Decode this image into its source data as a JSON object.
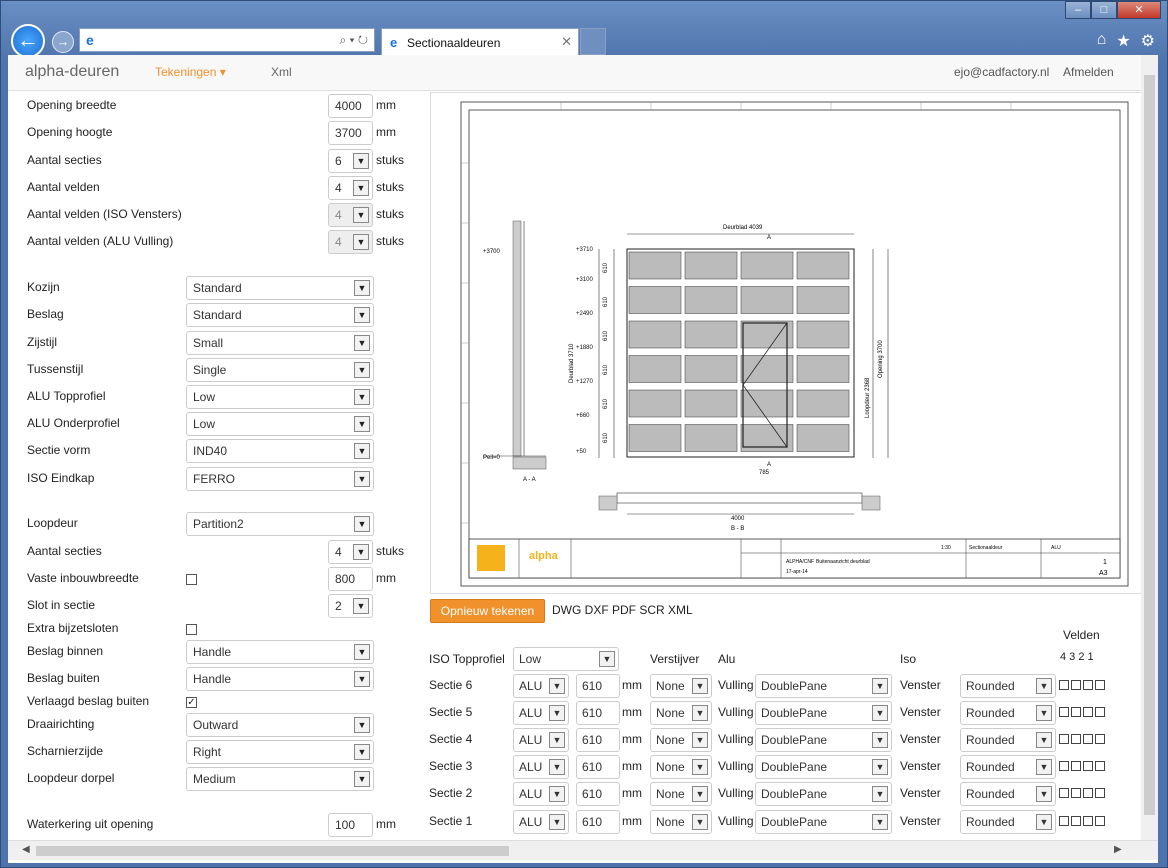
{
  "browser": {
    "tab_title": "Sectionaaldeuren",
    "address": ""
  },
  "nav": {
    "brand": "alpha-deuren",
    "menu_tekeningen": "Tekeningen",
    "menu_xml": "Xml",
    "user": "ejo@cadfactory.nl",
    "logout": "Afmelden"
  },
  "form1": [
    {
      "label": "Opening breedte",
      "value": "4000",
      "unit": "mm",
      "type": "input"
    },
    {
      "label": "Opening hoogte",
      "value": "3700",
      "unit": "mm",
      "type": "input"
    },
    {
      "label": "Aantal secties",
      "value": "6",
      "unit": "stuks",
      "type": "select"
    },
    {
      "label": "Aantal velden",
      "value": "4",
      "unit": "stuks",
      "type": "select"
    },
    {
      "label": "Aantal velden (ISO Vensters)",
      "value": "4",
      "unit": "stuks",
      "type": "select-disabled"
    },
    {
      "label": "Aantal velden (ALU Vulling)",
      "value": "4",
      "unit": "stuks",
      "type": "select-disabled"
    }
  ],
  "form2": [
    {
      "label": "Kozijn",
      "value": "Standard"
    },
    {
      "label": "Beslag",
      "value": "Standard"
    },
    {
      "label": "Zijstijl",
      "value": "Small"
    },
    {
      "label": "Tussenstijl",
      "value": "Single"
    },
    {
      "label": "ALU Topprofiel",
      "value": "Low"
    },
    {
      "label": "ALU Onderprofiel",
      "value": "Low"
    },
    {
      "label": "Sectie vorm",
      "value": "IND40"
    },
    {
      "label": "ISO Eindkap",
      "value": "FERRO"
    }
  ],
  "form3": {
    "loopdeur": {
      "label": "Loopdeur",
      "value": "Partition2"
    },
    "aantal_secties": {
      "label": "Aantal secties",
      "value": "4",
      "unit": "stuks"
    },
    "vaste": {
      "label": "Vaste inbouwbreedte",
      "value": "800",
      "unit": "mm"
    },
    "slot": {
      "label": "Slot in sectie",
      "value": "2"
    },
    "extra": {
      "label": "Extra bijzetsloten"
    },
    "beslag_binnen": {
      "label": "Beslag binnen",
      "value": "Handle"
    },
    "beslag_buiten": {
      "label": "Beslag buiten",
      "value": "Handle"
    },
    "verlaagd": {
      "label": "Verlaagd beslag buiten"
    },
    "draairichting": {
      "label": "Draairichting",
      "value": "Outward"
    },
    "scharnierzijde": {
      "label": "Scharnierzijde",
      "value": "Right"
    },
    "dorpel": {
      "label": "Loopdeur dorpel",
      "value": "Medium"
    },
    "waterkering": {
      "label": "Waterkering uit opening",
      "value": "100",
      "unit": "mm"
    }
  },
  "actions": {
    "redraw": "Opnieuw tekenen",
    "formats": "DWG DXF PDF SCR XML"
  },
  "sections_table": {
    "velden_title": "Velden",
    "velden_cols": "4 3 2 1",
    "iso_topprofiel_label": "ISO Topprofiel",
    "iso_topprofiel_value": "Low",
    "verstijver": "Verstijver",
    "alu": "Alu",
    "iso": "Iso",
    "rows": [
      {
        "label": "Sectie 6",
        "mat": "ALU",
        "height": "610",
        "unit": "mm",
        "verst": "None",
        "vul_label": "Vulling",
        "vulling": "DoublePane",
        "ven_label": "Venster",
        "venster": "Rounded"
      },
      {
        "label": "Sectie 5",
        "mat": "ALU",
        "height": "610",
        "unit": "mm",
        "verst": "None",
        "vul_label": "Vulling",
        "vulling": "DoublePane",
        "ven_label": "Venster",
        "venster": "Rounded"
      },
      {
        "label": "Sectie 4",
        "mat": "ALU",
        "height": "610",
        "unit": "mm",
        "verst": "None",
        "vul_label": "Vulling",
        "vulling": "DoublePane",
        "ven_label": "Venster",
        "venster": "Rounded"
      },
      {
        "label": "Sectie 3",
        "mat": "ALU",
        "height": "610",
        "unit": "mm",
        "verst": "None",
        "vul_label": "Vulling",
        "vulling": "DoublePane",
        "ven_label": "Venster",
        "venster": "Rounded"
      },
      {
        "label": "Sectie 2",
        "mat": "ALU",
        "height": "610",
        "unit": "mm",
        "verst": "None",
        "vul_label": "Vulling",
        "vulling": "DoublePane",
        "ven_label": "Venster",
        "venster": "Rounded"
      },
      {
        "label": "Sectie 1",
        "mat": "ALU",
        "height": "610",
        "unit": "mm",
        "verst": "None",
        "vul_label": "Vulling",
        "vulling": "DoublePane",
        "ven_label": "Venster",
        "venster": "Rounded"
      }
    ]
  },
  "drawing": {
    "deurblad": "Deurblad 4039",
    "levels": [
      "+3710",
      "+3100",
      "+2490",
      "+1880",
      "+1270",
      "+660",
      "+50"
    ],
    "seg": "610",
    "side_top": "+3700",
    "peil": "Peil=0",
    "view_aa": "A - A",
    "view_bb": "B - B",
    "width_bottom": "4000",
    "door_w": "785",
    "deurblad_h": "Deurblad 3710",
    "opening_h": "Opening 3700",
    "loopdeur_h": "Loopdeur 2368",
    "marker_a": "A",
    "marker_b": "B",
    "logo": "alpha",
    "tb_product": "Sectionaaldeur",
    "tb_mat": "ALU",
    "tb_schaal": "1:30",
    "tb_datum": "17-apr-14",
    "tb_ged": "ALPHA/CNF",
    "tb_benaming": "Buitenaanzicht deurblad",
    "tb_sheet": "1",
    "tb_format": "A3"
  }
}
